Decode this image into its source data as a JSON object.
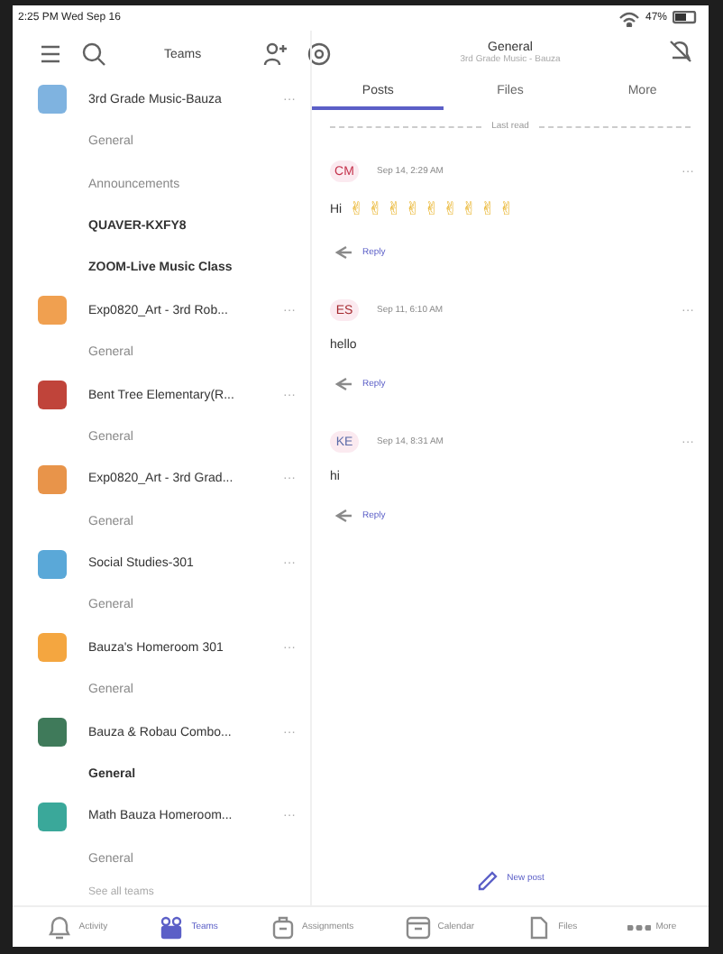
{
  "status_bar": {
    "time": "2:25 PM  Wed Sep 16",
    "battery": "47%"
  },
  "sidebar": {
    "title": "Teams",
    "teams": [
      {
        "name": "3rd Grade Music-Bauza",
        "color": "#7fb3e0",
        "more": "···",
        "channels": [
          {
            "name": "General",
            "unread": false
          },
          {
            "name": "Announcements",
            "unread": false
          },
          {
            "name": "QUAVER-KXFY8",
            "unread": true
          },
          {
            "name": "ZOOM-Live Music Class",
            "unread": true
          }
        ]
      },
      {
        "name": "Exp0820_Art - 3rd Rob...",
        "color": "#f0a050",
        "more": "···",
        "channels": [
          {
            "name": "General",
            "unread": false
          }
        ]
      },
      {
        "name": "Bent Tree Elementary(R...",
        "color": "#c0443a",
        "more": "···",
        "channels": [
          {
            "name": "General",
            "unread": false
          }
        ]
      },
      {
        "name": "Exp0820_Art - 3rd Grad...",
        "color": "#e8944a",
        "more": "···",
        "channels": [
          {
            "name": "General",
            "unread": false
          }
        ]
      },
      {
        "name": "Social Studies-301",
        "color": "#5aa8d8",
        "more": "···",
        "channels": [
          {
            "name": "General",
            "unread": false
          }
        ]
      },
      {
        "name": "Bauza's Homeroom 301",
        "color": "#f4a640",
        "more": "···",
        "channels": [
          {
            "name": "General",
            "unread": false
          }
        ]
      },
      {
        "name": "Bauza & Robau Combo...",
        "color": "#3f7a5a",
        "more": "···",
        "channels": [
          {
            "name": "General",
            "unread": true
          }
        ]
      },
      {
        "name": "Math Bauza Homeroom...",
        "color": "#3aa89a",
        "more": "···",
        "channels": [
          {
            "name": "General",
            "unread": false
          }
        ]
      }
    ],
    "see_all": "See all teams"
  },
  "channel": {
    "title": "General",
    "subtitle": "3rd Grade Music - Bauza",
    "tabs": [
      {
        "label": "Posts",
        "selected": true
      },
      {
        "label": "Files",
        "selected": false
      },
      {
        "label": "More",
        "selected": false
      }
    ],
    "last_read": "Last read",
    "posts": [
      {
        "initials": "CM",
        "color": "#c4314b",
        "time": "Sep 14, 2:29 AM",
        "text": "Hi",
        "emojis": [
          "✌",
          "✌",
          "✌",
          "✌",
          "✌",
          "✌",
          "✌",
          "✌",
          "✌"
        ],
        "reply": "Reply",
        "more": "···"
      },
      {
        "initials": "ES",
        "color": "#a4262c",
        "time": "Sep 11, 6:10 AM",
        "text": "hello",
        "reply": "Reply",
        "more": "···"
      },
      {
        "initials": "KE",
        "color": "#5b6ba8",
        "time": "Sep 14, 8:31 AM",
        "text": "hi",
        "reply": "Reply",
        "more": "···"
      }
    ],
    "new_post": "New post"
  },
  "bottom_nav": [
    {
      "label": "Activity",
      "selected": false
    },
    {
      "label": "Teams",
      "selected": true
    },
    {
      "label": "Assignments",
      "selected": false
    },
    {
      "label": "Calendar",
      "selected": false
    },
    {
      "label": "Files",
      "selected": false
    },
    {
      "label": "More",
      "selected": false
    }
  ]
}
